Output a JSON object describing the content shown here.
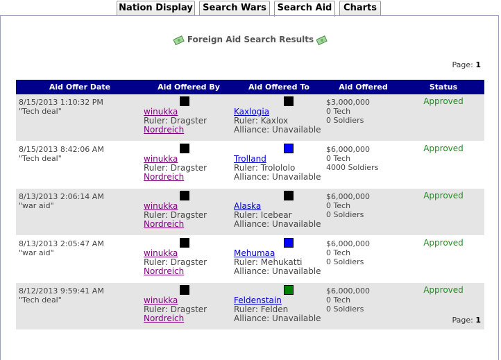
{
  "tabs": [
    {
      "label": "Nation Display"
    },
    {
      "label": "Search Wars"
    },
    {
      "label": "Search Aid"
    },
    {
      "label": "Charts"
    }
  ],
  "title": "Foreign Aid Search Results",
  "page": {
    "label": "Page:",
    "number": "1"
  },
  "columns": [
    "Aid Offer Date",
    "Aid Offered By",
    "Aid Offered To",
    "Aid Offered",
    "Status"
  ],
  "rows": [
    {
      "date": "8/15/2013 1:10:32 PM",
      "note": "\"Tech deal\"",
      "by": {
        "nation": "winukka",
        "ruler": "Ruler: Dragster",
        "alliance": "Nordreich",
        "flag": "#000000"
      },
      "to": {
        "nation": "Kaxlogia",
        "ruler": "Ruler: Kaxlox",
        "alliance": "Alliance: Unavailable",
        "flag": "#000000"
      },
      "aid": {
        "money": "$3,000,000",
        "tech": "0 Tech",
        "soldiers": "0 Soldiers"
      },
      "status": "Approved"
    },
    {
      "date": "8/15/2013 8:42:06 AM",
      "note": "\"Tech deal\"",
      "by": {
        "nation": "winukka",
        "ruler": "Ruler: Dragster",
        "alliance": "Nordreich",
        "flag": "#000000"
      },
      "to": {
        "nation": "Trolland",
        "ruler": "Ruler: Trolololo",
        "alliance": "Alliance: Unavailable",
        "flag": "#0000ff"
      },
      "aid": {
        "money": "$6,000,000",
        "tech": "0 Tech",
        "soldiers": "4000 Soldiers"
      },
      "status": "Approved"
    },
    {
      "date": "8/13/2013 2:06:14 AM",
      "note": "\"war aid\"",
      "by": {
        "nation": "winukka",
        "ruler": "Ruler: Dragster",
        "alliance": "Nordreich",
        "flag": "#000000"
      },
      "to": {
        "nation": "Alaska",
        "ruler": "Ruler: Icebear",
        "alliance": "Alliance: Unavailable",
        "flag": "#000000"
      },
      "aid": {
        "money": "$6,000,000",
        "tech": "0 Tech",
        "soldiers": "0 Soldiers"
      },
      "status": "Approved"
    },
    {
      "date": "8/13/2013 2:05:47 AM",
      "note": "\"war aid\"",
      "by": {
        "nation": "winukka",
        "ruler": "Ruler: Dragster",
        "alliance": "Nordreich",
        "flag": "#000000"
      },
      "to": {
        "nation": "Mehumaa",
        "ruler": "Ruler: Mehukatti",
        "alliance": "Alliance: Unavailable",
        "flag": "#0000ff"
      },
      "aid": {
        "money": "$6,000,000",
        "tech": "0 Tech",
        "soldiers": "0 Soldiers"
      },
      "status": "Approved"
    },
    {
      "date": "8/12/2013 9:59:41 AM",
      "note": "\"Tech deal\"",
      "by": {
        "nation": "winukka",
        "ruler": "Ruler: Dragster",
        "alliance": "Nordreich",
        "flag": "#000000"
      },
      "to": {
        "nation": "Feldenstain",
        "ruler": "Ruler: Felden",
        "alliance": "Alliance: Unavailable",
        "flag": "#008000"
      },
      "aid": {
        "money": "$6,000,000",
        "tech": "0 Tech",
        "soldiers": "0 Soldiers"
      },
      "status": "Approved"
    }
  ],
  "colors": {
    "header_bg": "#00008b",
    "approved": "#228b22",
    "link": "#800080",
    "nation_link": "#0000cc",
    "odd_row": "#e5e5e5"
  },
  "icons": {
    "title_left": "money-icon",
    "title_right": "money-icon"
  }
}
